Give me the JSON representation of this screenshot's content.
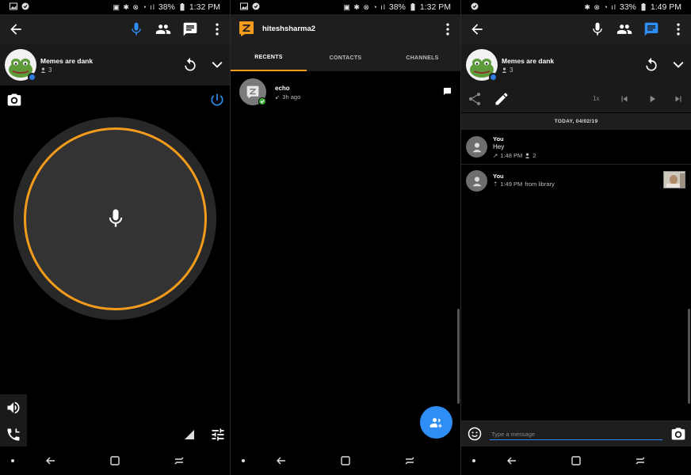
{
  "colors": {
    "accent_orange": "#f39b1c",
    "accent_blue": "#2f8ef5",
    "bar_dark": "#1e1e1e",
    "background": "#000000"
  },
  "screen1": {
    "status": {
      "battery": "38%",
      "time": "1:32 PM"
    },
    "conversation": {
      "name": "Memes are dank",
      "members": "3"
    },
    "icons": [
      "back-arrow-icon",
      "microphone-icon",
      "group-icon",
      "chat-icon",
      "more-vert-icon",
      "replay-icon",
      "chevron-down-icon",
      "camera-icon",
      "power-icon",
      "volume-icon",
      "phone-icon",
      "signal-icon",
      "tune-icon"
    ]
  },
  "screen2": {
    "status": {
      "battery": "38%",
      "time": "1:32 PM"
    },
    "username": "hiteshsharma2",
    "tabs": [
      {
        "label": "RECENTS",
        "active": true
      },
      {
        "label": "CONTACTS",
        "active": false
      },
      {
        "label": "CHANNELS",
        "active": false
      }
    ],
    "recents": [
      {
        "name": "echo",
        "time": "3h ago"
      }
    ]
  },
  "screen3": {
    "status": {
      "battery": "33%",
      "time": "1:49 PM"
    },
    "conversation": {
      "name": "Memes are dank",
      "members": "3"
    },
    "playback": {
      "speed": "1x"
    },
    "date_divider": "TODAY, 04/02/19",
    "messages": [
      {
        "sender": "You",
        "text": "Hey",
        "time": "1:48 PM",
        "listeners": "2"
      },
      {
        "sender": "You",
        "time": "1:49 PM",
        "source": "from library"
      }
    ],
    "composer": {
      "placeholder": "Type a message"
    }
  }
}
